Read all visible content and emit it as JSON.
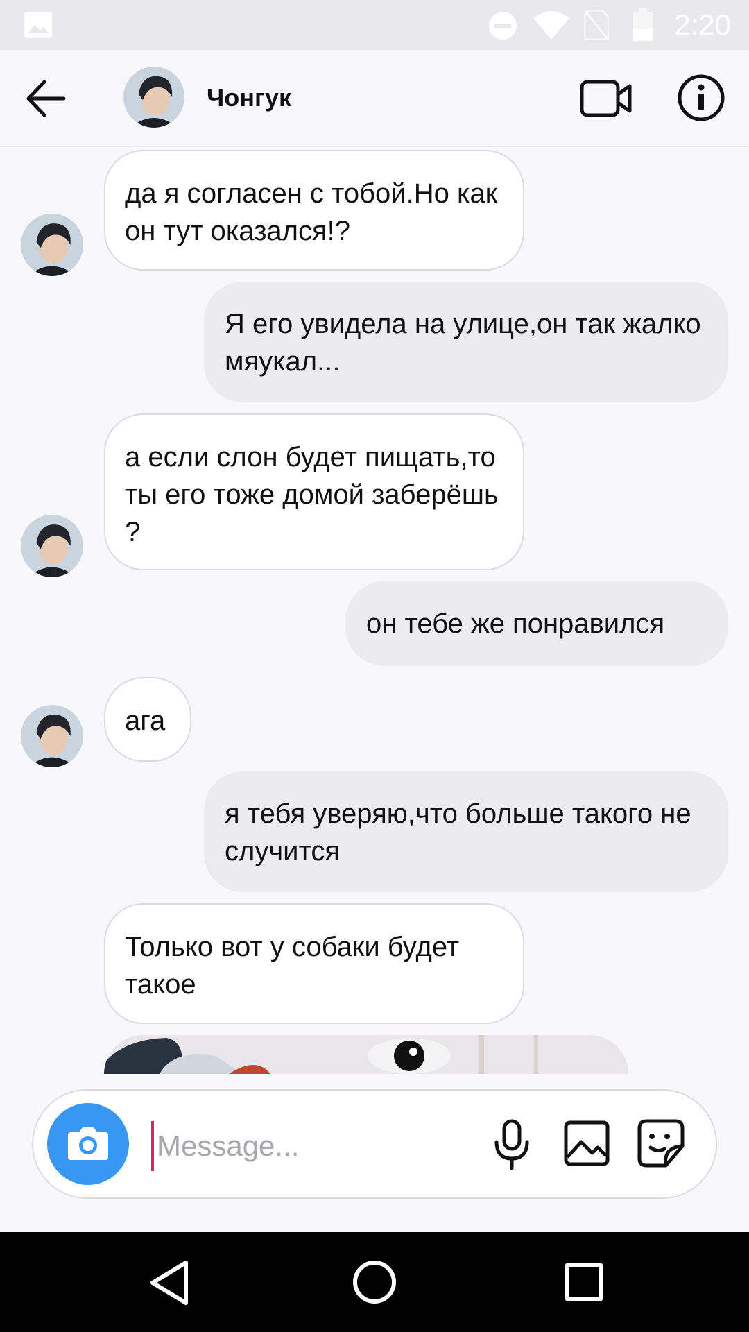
{
  "status_bar": {
    "time": "2:20",
    "icons": [
      "image-icon",
      "do-not-disturb-icon",
      "wifi-icon",
      "no-sim-icon",
      "battery-icon"
    ]
  },
  "header": {
    "contact_name": "Чонгук",
    "icons": [
      "back-arrow-icon",
      "video-call-icon",
      "info-icon"
    ]
  },
  "messages": [
    {
      "direction": "incoming",
      "text": "да я согласен с тобой.Но как он тут оказался!?"
    },
    {
      "direction": "outgoing",
      "text": "Я его увидела на улице,он так жалко мяукал..."
    },
    {
      "direction": "incoming",
      "text": "а если слон будет пищать,то ты его тоже домой заберёшь ?"
    },
    {
      "direction": "outgoing",
      "text": "он тебе же понравился"
    },
    {
      "direction": "incoming",
      "text": "ага"
    },
    {
      "direction": "outgoing",
      "text": "я тебя уверяю,что больше такого не случится"
    },
    {
      "direction": "incoming",
      "text": "Только вот у собаки будет такое"
    },
    {
      "direction": "incoming",
      "type": "photo",
      "text": ""
    }
  ],
  "composer": {
    "placeholder": "Message...",
    "value": "",
    "icons": [
      "camera-icon",
      "microphone-icon",
      "gallery-icon",
      "sticker-icon"
    ]
  },
  "nav_bar": {
    "icons": [
      "nav-back-icon",
      "nav-home-icon",
      "nav-recents-icon"
    ]
  },
  "colors": {
    "accent_blue": "#3897f0",
    "incoming_bubble": "#ffffff",
    "outgoing_bubble": "#ececef",
    "background": "#f8f7fa"
  }
}
